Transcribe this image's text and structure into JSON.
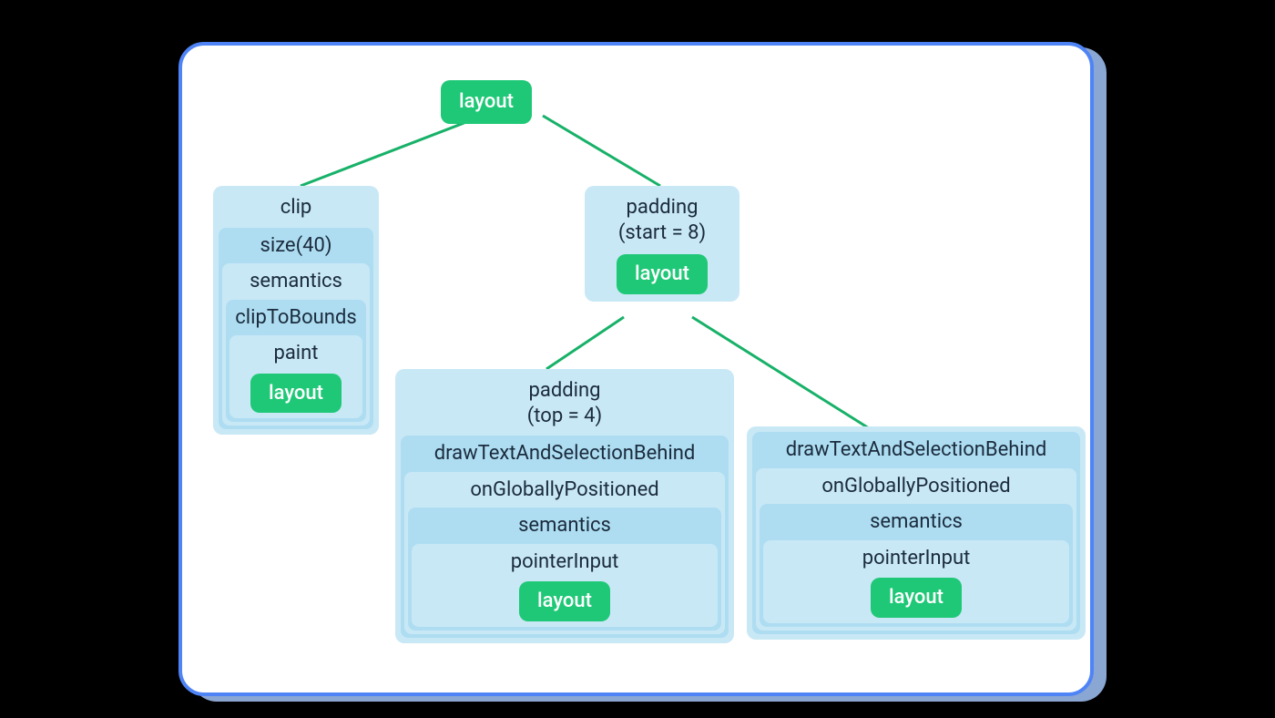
{
  "root": {
    "label": "layout"
  },
  "left": {
    "l0": "clip",
    "l1": "size(40)",
    "l2": "semantics",
    "l3": "clipToBounds",
    "l4": "paint",
    "leaf": "layout"
  },
  "mid": {
    "l0": "padding\n(start = 8)",
    "leaf": "layout"
  },
  "child_a": {
    "l0": "padding\n(top = 4)",
    "l1": "drawTextAndSelectionBehind",
    "l2": "onGloballyPositioned",
    "l3": "semantics",
    "l4": "pointerInput",
    "leaf": "layout"
  },
  "child_b": {
    "l0": "drawTextAndSelectionBehind",
    "l1": "onGloballyPositioned",
    "l2": "semantics",
    "l3": "pointerInput",
    "leaf": "layout"
  }
}
